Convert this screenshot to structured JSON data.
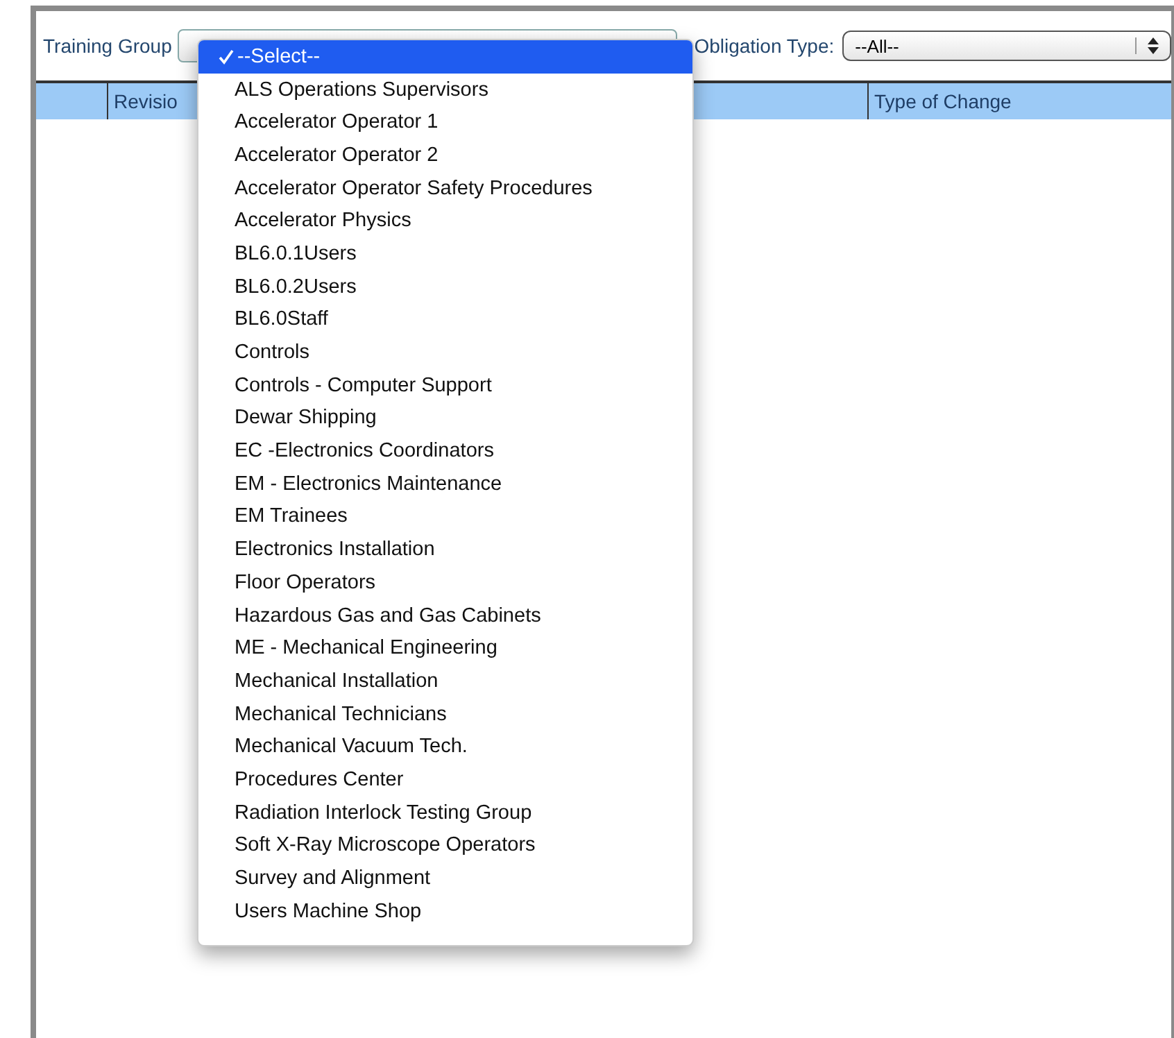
{
  "filters": {
    "training_group": {
      "label": "Training Group"
    },
    "obligation_type": {
      "label": "Obligation Type:",
      "value": "--All--"
    }
  },
  "table": {
    "columns": [
      "Revisio",
      "Type of Change"
    ]
  },
  "dropdown_menu": {
    "items": [
      {
        "label": "--Select--",
        "selected": true
      },
      {
        "label": "ALS Operations Supervisors",
        "selected": false
      },
      {
        "label": "Accelerator Operator 1",
        "selected": false
      },
      {
        "label": "Accelerator Operator 2",
        "selected": false
      },
      {
        "label": "Accelerator Operator Safety Procedures",
        "selected": false
      },
      {
        "label": "Accelerator Physics",
        "selected": false
      },
      {
        "label": "BL6.0.1Users",
        "selected": false
      },
      {
        "label": "BL6.0.2Users",
        "selected": false
      },
      {
        "label": "BL6.0Staff",
        "selected": false
      },
      {
        "label": "Controls",
        "selected": false
      },
      {
        "label": "Controls - Computer Support",
        "selected": false
      },
      {
        "label": "Dewar Shipping",
        "selected": false
      },
      {
        "label": "EC -Electronics Coordinators",
        "selected": false
      },
      {
        "label": "EM - Electronics Maintenance",
        "selected": false
      },
      {
        "label": "EM Trainees",
        "selected": false
      },
      {
        "label": "Electronics Installation",
        "selected": false
      },
      {
        "label": "Floor Operators",
        "selected": false
      },
      {
        "label": "Hazardous Gas and Gas Cabinets",
        "selected": false
      },
      {
        "label": "ME - Mechanical Engineering",
        "selected": false
      },
      {
        "label": "Mechanical Installation",
        "selected": false
      },
      {
        "label": "Mechanical Technicians",
        "selected": false
      },
      {
        "label": "Mechanical Vacuum Tech.",
        "selected": false
      },
      {
        "label": "Procedures Center",
        "selected": false
      },
      {
        "label": "Radiation Interlock Testing Group",
        "selected": false
      },
      {
        "label": "Soft X-Ray Microscope Operators",
        "selected": false
      },
      {
        "label": "Survey and Alignment",
        "selected": false
      },
      {
        "label": "Users Machine Shop",
        "selected": false
      }
    ]
  }
}
